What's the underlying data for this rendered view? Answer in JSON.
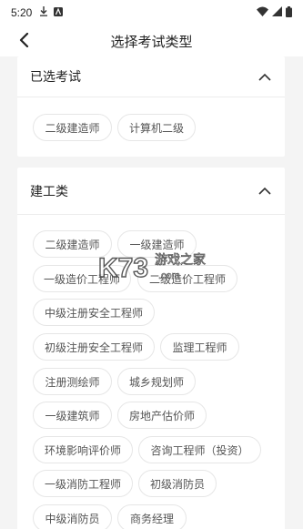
{
  "status_bar": {
    "time": "5:20",
    "left_icons": [
      "download-icon",
      "app-a-icon"
    ],
    "right_icons": [
      "wifi-icon",
      "signal-icon",
      "battery-icon"
    ]
  },
  "header": {
    "title": "选择考试类型",
    "back_icon": "chevron-left-icon"
  },
  "selected_section": {
    "title": "已选考试",
    "toggle_icon": "chevron-up-icon",
    "tags": [
      "二级建造师",
      "计算机二级"
    ]
  },
  "construction_section": {
    "title": "建工类",
    "toggle_icon": "chevron-up-icon",
    "tags": [
      "二级建造师",
      "一级建造师",
      "一级造价工程师",
      "二级造价工程师",
      "中级注册安全工程师",
      "初级注册安全工程师",
      "监理工程师",
      "注册测绘师",
      "城乡规划师",
      "一级建筑师",
      "房地产估价师",
      "环境影响评价师",
      "咨询工程师（投资）",
      "一级消防工程师",
      "初级消防员",
      "中级消防员",
      "商务经理"
    ]
  },
  "watermark": {
    "brand": "K73",
    "text": "游戏之家",
    "url": ".com"
  },
  "colors": {
    "background": "#f4f4f4",
    "card": "#ffffff",
    "tag_border": "#e6e6e6",
    "tag_text": "#555555",
    "title_text": "#222222"
  }
}
